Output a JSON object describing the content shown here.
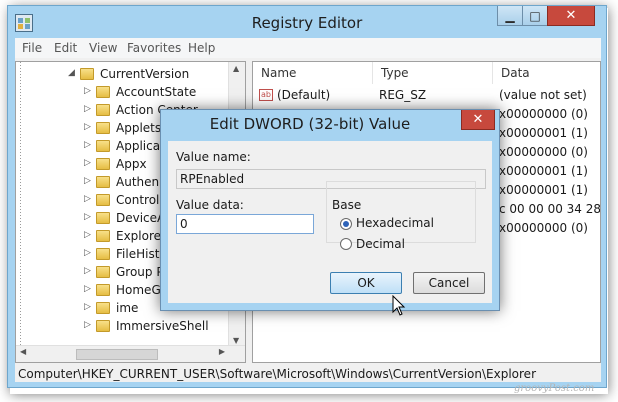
{
  "window": {
    "title": "Registry Editor"
  },
  "menu": [
    "File",
    "Edit",
    "View",
    "Favorites",
    "Help"
  ],
  "tree": {
    "expanded_node": "CurrentVersion",
    "children": [
      "AccountState",
      "Action Center",
      "Applets",
      "Applica",
      "Appx",
      "Authen",
      "Control",
      "DeviceA",
      "Explore",
      "FileHist",
      "Group P",
      "HomeG",
      "ime",
      "ImmersiveShell"
    ]
  },
  "list": {
    "headers": {
      "name": "Name",
      "type": "Type",
      "data": "Data"
    },
    "rows": [
      {
        "name": "(Default)",
        "type": "REG_SZ",
        "data": "(value not set)"
      },
      {
        "name": "",
        "type": "",
        "data": "x00000000 (0)"
      },
      {
        "name": "",
        "type": "",
        "data": "x00000001 (1)"
      },
      {
        "name": "",
        "type": "",
        "data": "x00000000 (0)"
      },
      {
        "name": "",
        "type": "",
        "data": "x00000001 (1)"
      },
      {
        "name": "",
        "type": "",
        "data": "x00000001 (1)"
      },
      {
        "name": "",
        "type": "",
        "data": "c 00 00 00 34 28 00"
      },
      {
        "name": "",
        "type": "",
        "data": "x00000000 (0)"
      }
    ]
  },
  "status_path": "Computer\\HKEY_CURRENT_USER\\Software\\Microsoft\\Windows\\CurrentVersion\\Explorer",
  "dialog": {
    "title": "Edit DWORD (32-bit) Value",
    "value_name_label": "Value name:",
    "value_name": "RPEnabled",
    "value_data_label": "Value data:",
    "value_data": "0",
    "base_label": "Base",
    "hex_label": "Hexadecimal",
    "dec_label": "Decimal",
    "selected_base": "Hexadecimal",
    "ok_label": "OK",
    "cancel_label": "Cancel"
  },
  "watermark": "groovyPost.com",
  "colors": {
    "chrome": "#a6d3f1",
    "close": "#c7493d",
    "accent": "#3c7fb1"
  }
}
